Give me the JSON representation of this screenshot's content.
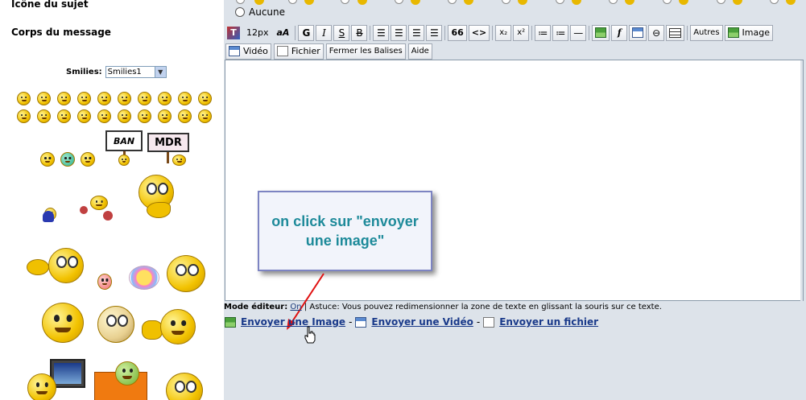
{
  "left": {
    "icon_label": "Icône du sujet",
    "body_label": "Corps du message",
    "smilies_label": "Smilies:",
    "smilies_select": "Smilies1",
    "sign_ban": "BAN",
    "sign_mdr": "MDR"
  },
  "topic": {
    "none_label": "Aucune"
  },
  "toolbar": {
    "font_size": "12px",
    "font_case": "aA",
    "bold": "G",
    "italic": "I",
    "underline": "S",
    "strike": "B",
    "quote": "66",
    "code": "<>",
    "sub": "x₂",
    "sup": "x²",
    "autres": "Autres",
    "image": "Image",
    "video": "Vidéo",
    "fichier": "Fichier",
    "fermer": "Fermer les Balises",
    "aide": "Aide"
  },
  "callout": {
    "text": "on click sur \"envoyer une image\""
  },
  "footer": {
    "mode_label": "Mode éditeur:",
    "mode_value": "On",
    "tip": " | Astuce: Vous pouvez redimensionner la zone de texte en glissant la souris sur ce texte.",
    "send_image": "Envoyer une Image",
    "send_video": "Envoyer une Vidéo",
    "send_file": "Envoyer un fichier",
    "dash": "-"
  }
}
